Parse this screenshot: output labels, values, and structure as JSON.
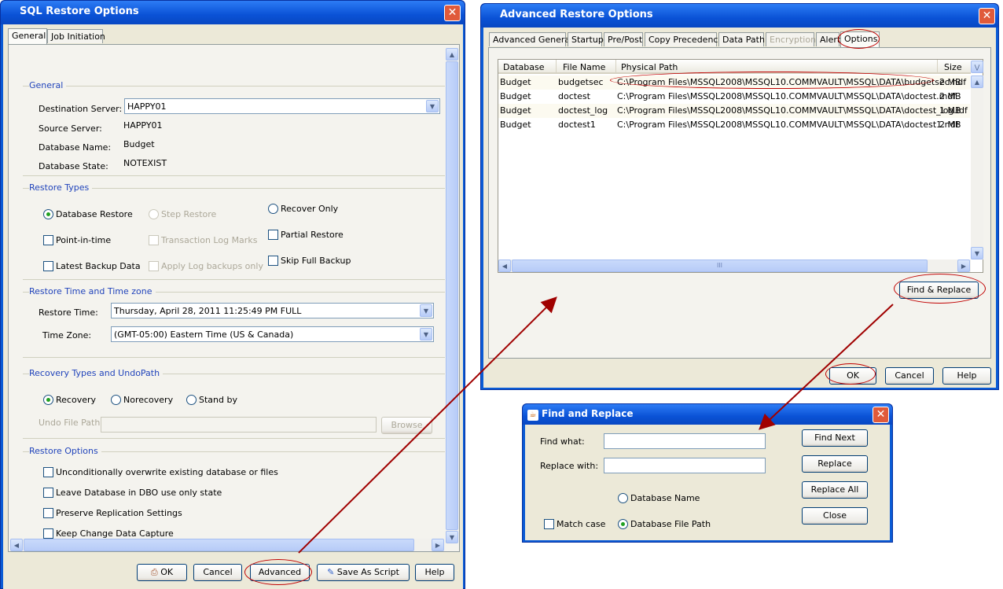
{
  "sql_window": {
    "title": "SQL Restore Options",
    "tabs": [
      "General",
      "Job Initiation"
    ],
    "general": {
      "section": "General",
      "destination_server_label": "Destination Server:",
      "destination_server_value": "HAPPY01",
      "source_server_label": "Source Server:",
      "source_server_value": "HAPPY01",
      "database_name_label": "Database Name:",
      "database_name_value": "Budget",
      "database_state_label": "Database State:",
      "database_state_value": "NOTEXIST"
    },
    "restore_types": {
      "section": "Restore Types",
      "database_restore": "Database Restore",
      "step_restore": "Step Restore",
      "recover_only": "Recover Only",
      "point_in_time": "Point-in-time",
      "transaction_log_marks": "Transaction Log Marks",
      "partial_restore": "Partial Restore",
      "latest_backup_data": "Latest Backup Data",
      "apply_log_backups_only": "Apply Log backups only",
      "skip_full_backup": "Skip Full Backup"
    },
    "restore_time": {
      "section": "Restore Time and Time zone",
      "restore_time_label": "Restore Time:",
      "restore_time_value": "Thursday, April 28, 2011 11:25:49 PM FULL",
      "time_zone_label": "Time Zone:",
      "time_zone_value": "(GMT-05:00) Eastern Time (US & Canada)"
    },
    "recovery": {
      "section": "Recovery Types and UndoPath",
      "recovery": "Recovery",
      "norecovery": "Norecovery",
      "stand_by": "Stand by",
      "undo_file_path_label": "Undo File Path:",
      "undo_file_path_value": "",
      "browse": "Browse"
    },
    "restore_options": {
      "section": "Restore Options",
      "unconditionally_overwrite": "Unconditionally overwrite existing database or files",
      "leave_dbo_only": "Leave Database in DBO use only state",
      "preserve_replication": "Preserve Replication Settings",
      "keep_change_data_capture": "Keep Change Data Capture"
    },
    "buttons": {
      "ok": "OK",
      "cancel": "Cancel",
      "advanced": "Advanced",
      "save_as_script": "Save As Script",
      "help": "Help"
    }
  },
  "advanced_window": {
    "title": "Advanced Restore Options",
    "tabs": [
      "Advanced General",
      "Startup",
      "Pre/Post",
      "Copy Precedence",
      "Data Path",
      "Encryption",
      "Alert",
      "Options"
    ],
    "columns": [
      "Database",
      "File Name",
      "Physical Path",
      "Size"
    ],
    "rows": [
      [
        "Budget",
        "budgetsec",
        "C:\\Program Files\\MSSQL2008\\MSSQL10.COMMVAULT\\MSSQL\\DATA\\budgetsec.ndf",
        "2 MB"
      ],
      [
        "Budget",
        "doctest",
        "C:\\Program Files\\MSSQL2008\\MSSQL10.COMMVAULT\\MSSQL\\DATA\\doctest.mdf",
        "2 MB"
      ],
      [
        "Budget",
        "doctest_log",
        "C:\\Program Files\\MSSQL2008\\MSSQL10.COMMVAULT\\MSSQL\\DATA\\doctest_log.ldf",
        "1 MB"
      ],
      [
        "Budget",
        "doctest1",
        "C:\\Program Files\\MSSQL2008\\MSSQL10.COMMVAULT\\MSSQL\\DATA\\doctest1.ndf",
        "2 MB"
      ]
    ],
    "scroll_grip": "III",
    "buttons": {
      "find_replace": "Find & Replace",
      "ok": "OK",
      "cancel": "Cancel",
      "help": "Help"
    }
  },
  "find_window": {
    "title": "Find and Replace",
    "find_what_label": "Find what:",
    "find_what_value": "",
    "replace_with_label": "Replace with:",
    "replace_with_value": "",
    "database_name": "Database Name",
    "database_file_path": "Database File Path",
    "match_case": "Match case",
    "buttons": {
      "find_next": "Find Next",
      "replace": "Replace",
      "replace_all": "Replace All",
      "close": "Close"
    }
  },
  "colors": {
    "title_blue": "#0a52d6",
    "section_blue": "#2144bb",
    "annotation_red": "#c00000",
    "dialog_bg": "#ece9d8"
  }
}
